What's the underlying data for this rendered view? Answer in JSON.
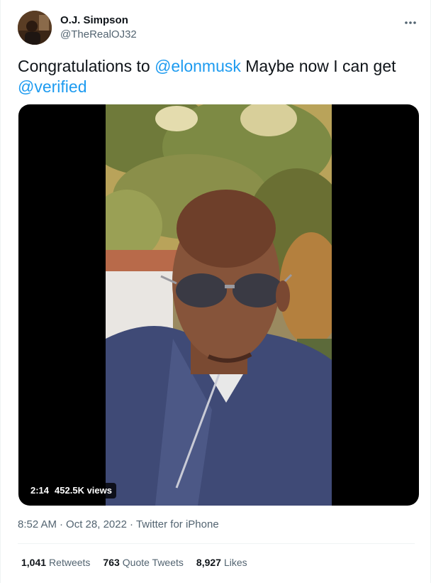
{
  "author": {
    "display_name": "O.J. Simpson",
    "handle": "@TheRealOJ32",
    "avatar_icon": "profile-photo"
  },
  "more_icon": "more-options-icon",
  "tweet": {
    "text_1": "Congratulations to ",
    "mention_1": "@elonmusk",
    "text_2": " Maybe now I can get ",
    "mention_2": "@verified"
  },
  "media": {
    "duration": "2:14",
    "views": "452.5K views"
  },
  "meta": {
    "time": "8:52 AM",
    "separator_1": "·",
    "date": "Oct 28, 2022",
    "separator_2": "·",
    "source": "Twitter for iPhone"
  },
  "stats": {
    "retweets_count": "1,041",
    "retweets_label": "Retweets",
    "quote_count": "763",
    "quote_label": "Quote Tweets",
    "likes_count": "8,927",
    "likes_label": "Likes"
  },
  "colors": {
    "link": "#1d9bf0",
    "secondary_text": "#536471",
    "primary_text": "#0f1419",
    "divider": "#eff3f4"
  }
}
